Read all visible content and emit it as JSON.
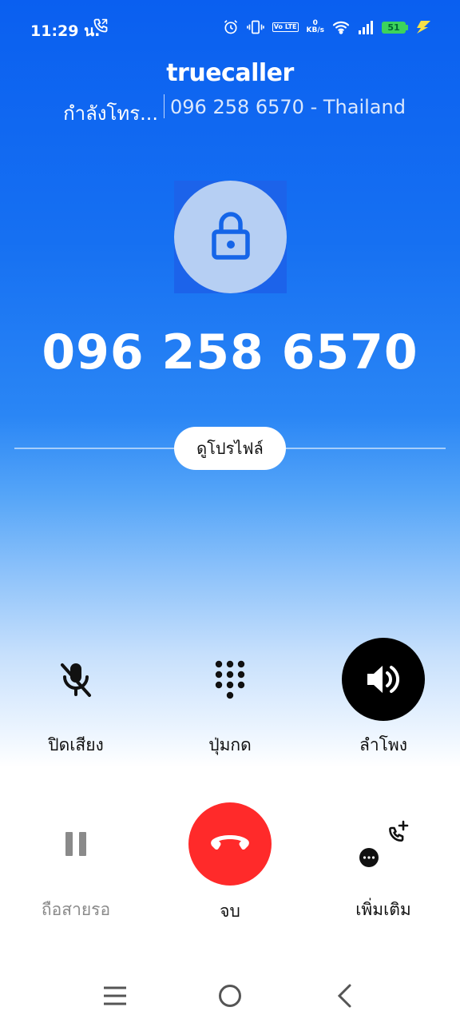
{
  "status_bar": {
    "time": "11:29 น.",
    "net_speed_value": "0",
    "net_speed_unit": "KB/s",
    "volte": "Vo LTE",
    "battery": "51"
  },
  "header": {
    "brand": "truecaller",
    "calling_label": "กำลังโทร...",
    "caller_info": "096 258 6570 - Thailand"
  },
  "avatar": {
    "icon": "lock-icon"
  },
  "phone_number": "096 258 6570",
  "profile_button": "ดูโปรไฟล์",
  "controls": {
    "mute": {
      "label": "ปิดเสียง",
      "icon": "mic-off-icon"
    },
    "keypad": {
      "label": "ปุ่มกด",
      "icon": "keypad-icon"
    },
    "speaker": {
      "label": "ลำโพง",
      "icon": "speaker-icon",
      "active": true
    },
    "hold": {
      "label": "ถือสายรอ",
      "icon": "pause-icon",
      "enabled": false
    },
    "end": {
      "label": "จบ",
      "icon": "end-call-icon",
      "color": "#ff2a2a"
    },
    "more": {
      "label": "เพิ่มเติม",
      "icon": "add-call-icon"
    }
  },
  "colors": {
    "accent": "#0a5ff0",
    "end_call": "#ff2a2a"
  }
}
